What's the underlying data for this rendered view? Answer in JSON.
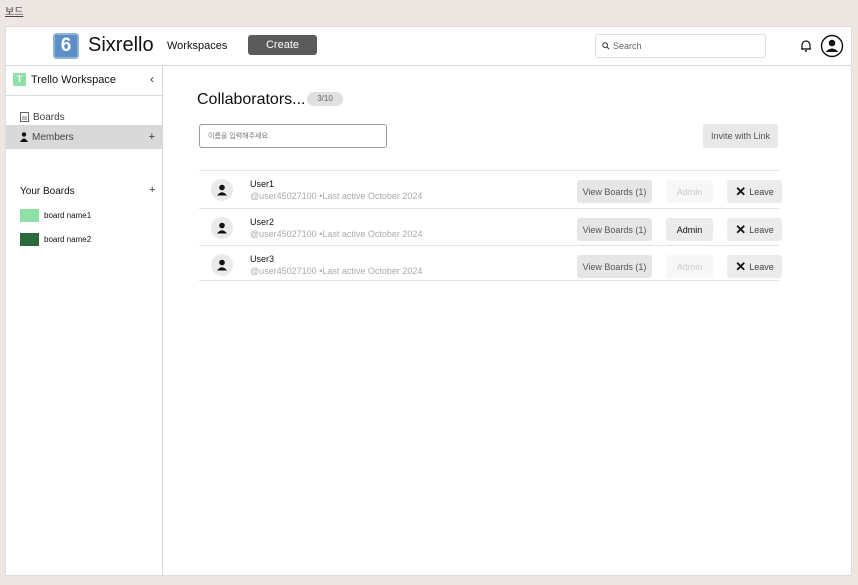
{
  "page_label": "보드",
  "header": {
    "logo_glyph": "6",
    "app_name": "Sixrello",
    "nav_workspaces": "Workspaces",
    "create_label": "Create",
    "search_placeholder": "Search",
    "icons": [
      "search-icon",
      "bell-icon",
      "account-icon"
    ]
  },
  "sidebar": {
    "workspace_badge": "T",
    "workspace_name": "Trello Workspace",
    "collapse_glyph": "‹",
    "items": [
      {
        "label": "Boards",
        "icon": "board-icon",
        "active": false
      },
      {
        "label": "Members",
        "icon": "person-icon",
        "active": true,
        "action": "+"
      }
    ],
    "your_boards_label": "Your Boards",
    "your_boards_action": "+",
    "boards": [
      {
        "name": "board name1",
        "color": "#8ee0a6"
      },
      {
        "name": "board name2",
        "color": "#2a6a3a"
      }
    ]
  },
  "main": {
    "title": "Collaborators...",
    "count": "3/10",
    "name_input_placeholder": "이름을 입력해주세요.",
    "invite_label": "Invite with Link",
    "members": [
      {
        "name": "User1",
        "meta": "@user45027100 •Last active October 2024",
        "view_label": "View Boards (1)",
        "admin_label": "Admin",
        "admin_enabled": false,
        "leave_label": "Leave"
      },
      {
        "name": "User2",
        "meta": "@user45027100 •Last active October 2024",
        "view_label": "View Boards (1)",
        "admin_label": "Admin",
        "admin_enabled": true,
        "leave_label": "Leave"
      },
      {
        "name": "User3",
        "meta": "@user45027100 •Last active October 2024",
        "view_label": "View Boards (1)",
        "admin_label": "Admin",
        "admin_enabled": false,
        "leave_label": "Leave"
      }
    ]
  },
  "colors": {
    "page_bg": "#ede6e3",
    "create_button": "#5a5a5a",
    "active_sidebar": "#d9d9d9",
    "logo": "#5b8fc6"
  }
}
